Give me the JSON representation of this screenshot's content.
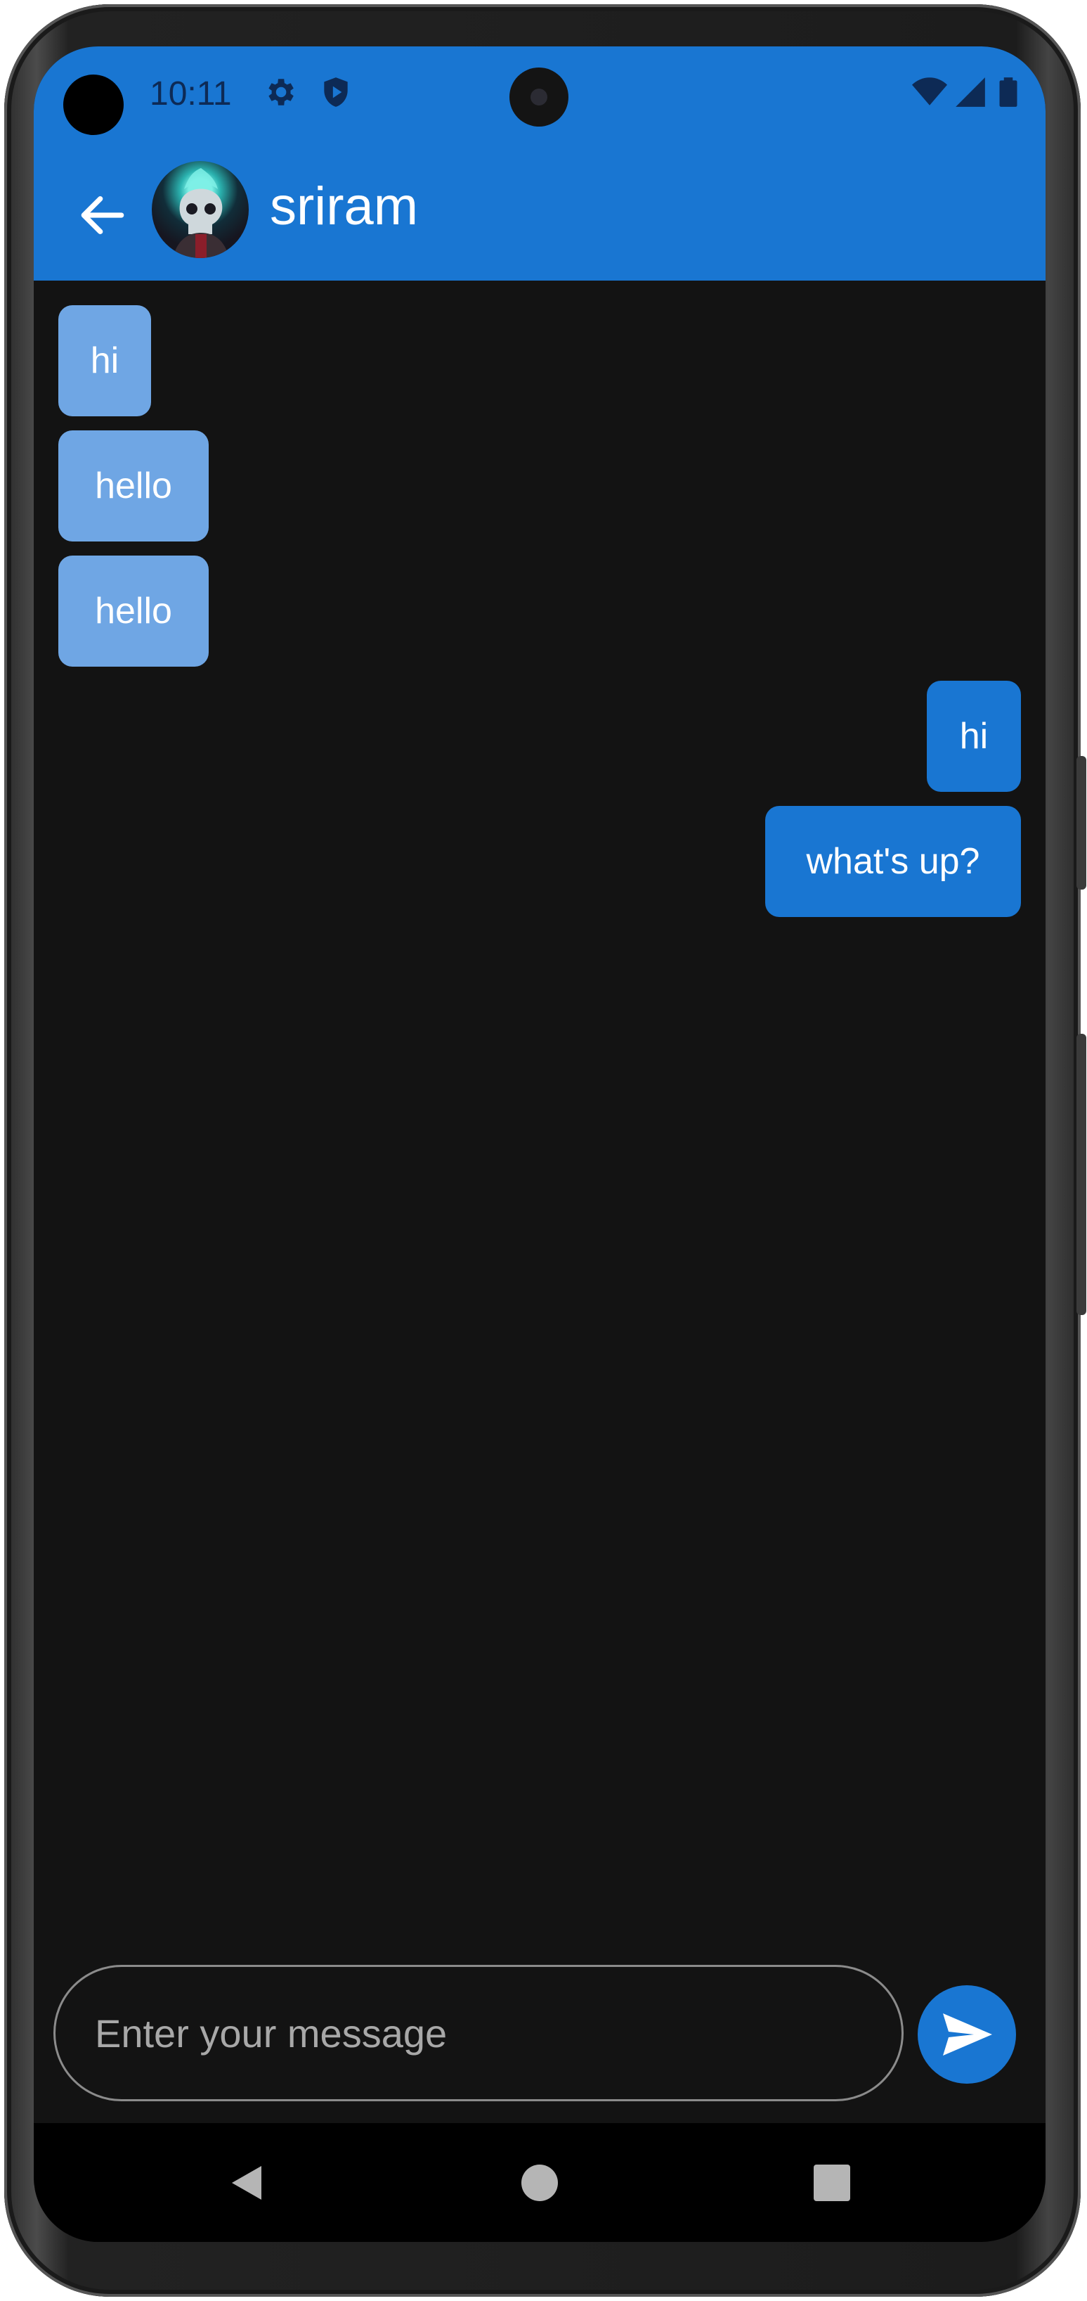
{
  "status_bar": {
    "time": "10:11",
    "icons": [
      "settings-icon",
      "shield-play-icon",
      "wifi-icon",
      "cellular-signal-icon",
      "battery-icon"
    ]
  },
  "header": {
    "title": "sriram",
    "back_icon": "arrow-back-icon",
    "avatar": "contact-avatar"
  },
  "messages": [
    {
      "side": "incoming",
      "text": "hi"
    },
    {
      "side": "incoming",
      "text": "hello"
    },
    {
      "side": "incoming",
      "text": "hello"
    },
    {
      "side": "outgoing",
      "text": "hi"
    },
    {
      "side": "outgoing",
      "text": "what's up?"
    }
  ],
  "composer": {
    "placeholder": "Enter your message",
    "send_icon": "send-icon"
  },
  "nav_bar": {
    "icons": [
      "back-triangle-icon",
      "home-circle-icon",
      "recents-square-icon"
    ]
  },
  "colors": {
    "app_bar": "#1976d2",
    "incoming_bubble": "#6fa6e4",
    "outgoing_bubble": "#1976d2",
    "background": "#131313"
  }
}
